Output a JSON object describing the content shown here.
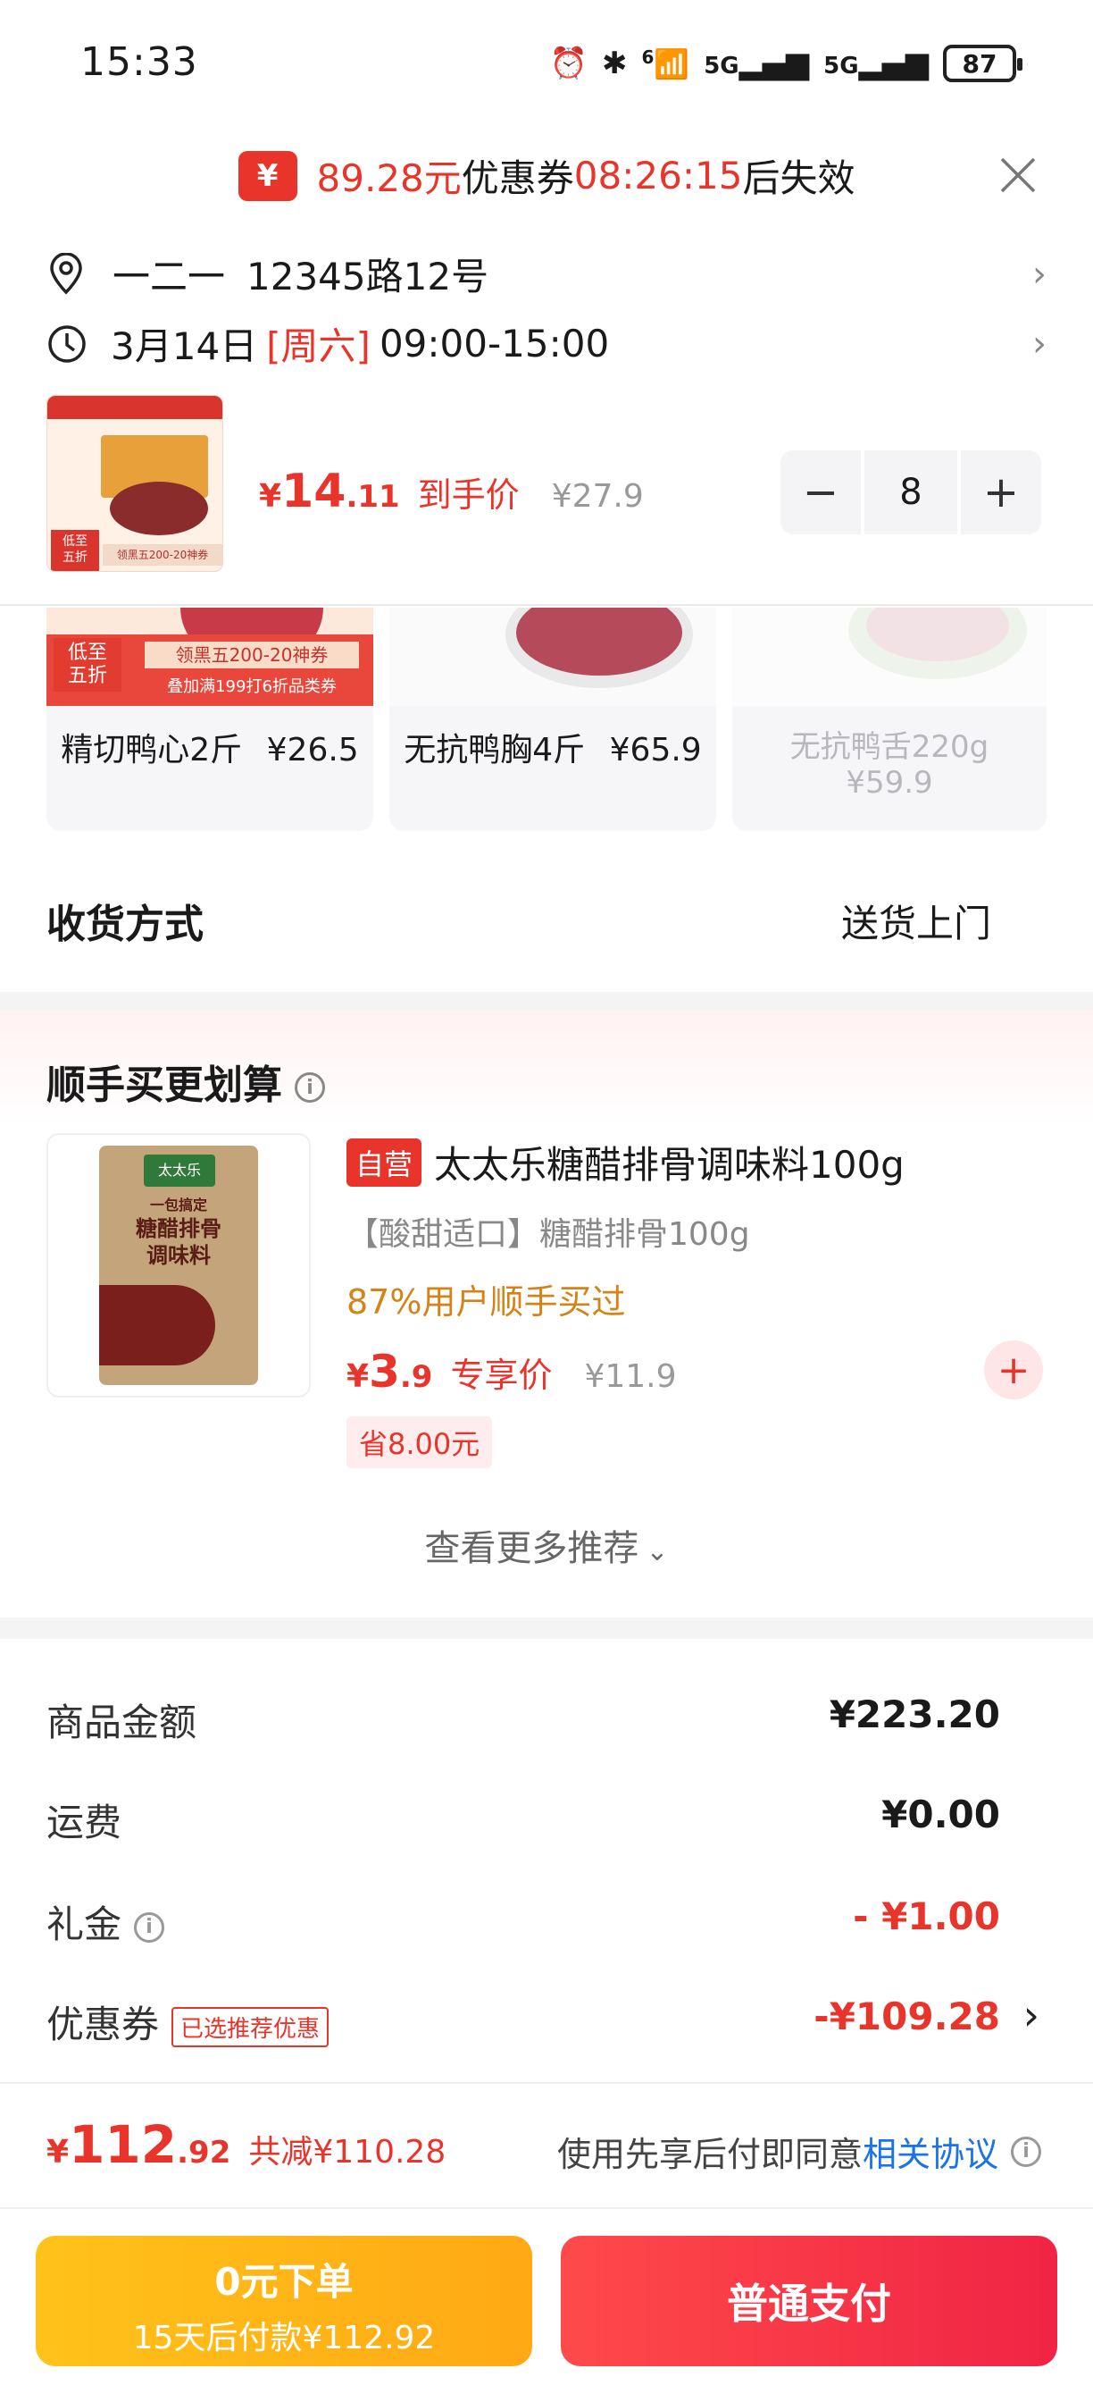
{
  "status_bar": {
    "time": "15:33",
    "battery": "87",
    "network_1": "5G",
    "network_2": "5G",
    "wifi_badge": "6"
  },
  "coupon_banner": {
    "icon": "¥",
    "amount": "89.28元",
    "label": "优惠券",
    "countdown": "08:26:15",
    "suffix": "后失效"
  },
  "address": {
    "name": "一二一",
    "line": "12345路12号"
  },
  "delivery_time": {
    "date": "3月14日",
    "weekday": "[周六]",
    "window": "09:00-15:00"
  },
  "product": {
    "price_symbol": "¥",
    "price_int": "14",
    "price_dec": ".11",
    "price_tag": "到手价",
    "original_price": "¥27.9",
    "quantity": "8",
    "thumb_badge": "低至\n五折",
    "thumb_banner": "领黑五200-20神券"
  },
  "carousel": [
    {
      "name": "精切鸭心2斤",
      "price": "¥26.5",
      "badge": "低至\n五折",
      "banner1": "领黑五200-20神券",
      "banner2": "叠加满199打6折品类券"
    },
    {
      "name": "无抗鸭胸4斤",
      "price": "¥65.9"
    },
    {
      "name": "无抗鸭舌220g",
      "price": "¥59.9"
    }
  ],
  "delivery": {
    "label": "收货方式",
    "value": "送货上门"
  },
  "recommend": {
    "title": "顺手买更划算",
    "item": {
      "self_tag": "自营",
      "title": "太太乐糖醋排骨调味料100g",
      "subtitle": "【酸甜适口】糖醋排骨100g",
      "stat": "87%用户顺手买过",
      "price_symbol": "¥",
      "price_int": "3",
      "price_dec": ".9",
      "price_tag": "专享价",
      "original_price": "¥11.9",
      "save": "省8.00元",
      "pack_brand": "太太乐",
      "pack_lines": [
        "一包搞定",
        "糖醋排骨",
        "调味料"
      ]
    },
    "more": "查看更多推荐"
  },
  "totals": {
    "goods_label": "商品金额",
    "goods_value": "¥223.20",
    "shipping_label": "运费",
    "shipping_value": "¥0.00",
    "gift_label": "礼金",
    "gift_value": "- ¥1.00",
    "coupon_label": "优惠券",
    "coupon_tag": "已选推荐优惠",
    "coupon_value": "-¥109.28"
  },
  "summary": {
    "price_symbol": "¥",
    "price_int": "112",
    "price_dec": ".92",
    "reduced": "共减¥110.28",
    "agree_text": "使用先享后付即同意",
    "agree_link": "相关协议"
  },
  "buttons": {
    "later_title": "0元下单",
    "later_sub": "15天后付款¥112.92",
    "pay": "普通支付"
  },
  "colors": {
    "accent": "#e8342a",
    "pay_left": "#ffb414",
    "pay_right": "#f5304a",
    "link": "#1a73e8"
  }
}
